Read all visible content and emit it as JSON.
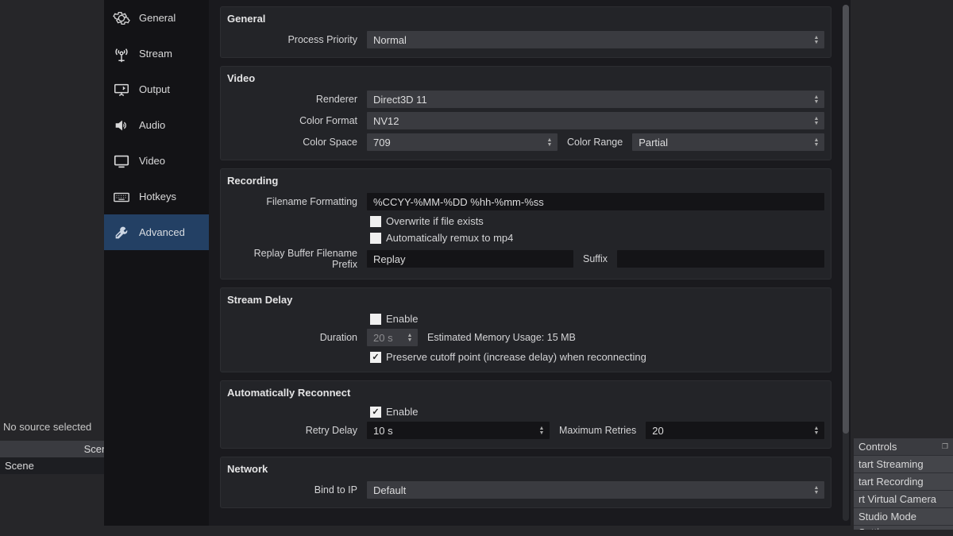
{
  "peek": {
    "no_source": "No source selected",
    "scenes_header": "Scenes",
    "scene_name": "Scene",
    "controls_header": "Controls",
    "buttons": {
      "start_stream": "tart Streaming",
      "start_record": "tart Recording",
      "virtual_cam": "rt Virtual Camera",
      "studio": "Studio Mode",
      "settings": "Settings"
    }
  },
  "sidebar": {
    "items": [
      {
        "label": "General"
      },
      {
        "label": "Stream"
      },
      {
        "label": "Output"
      },
      {
        "label": "Audio"
      },
      {
        "label": "Video"
      },
      {
        "label": "Hotkeys"
      },
      {
        "label": "Advanced"
      }
    ]
  },
  "sections": {
    "general": {
      "title": "General",
      "process_priority_label": "Process Priority",
      "process_priority_value": "Normal"
    },
    "video": {
      "title": "Video",
      "renderer_label": "Renderer",
      "renderer_value": "Direct3D 11",
      "color_format_label": "Color Format",
      "color_format_value": "NV12",
      "color_space_label": "Color Space",
      "color_space_value": "709",
      "color_range_label": "Color Range",
      "color_range_value": "Partial"
    },
    "recording": {
      "title": "Recording",
      "filename_fmt_label": "Filename Formatting",
      "filename_fmt_value": "%CCYY-%MM-%DD %hh-%mm-%ss",
      "overwrite_label": "Overwrite if file exists",
      "remux_label": "Automatically remux to mp4",
      "replay_prefix_label": "Replay Buffer Filename Prefix",
      "replay_prefix_value": "Replay",
      "suffix_label": "Suffix",
      "suffix_value": ""
    },
    "stream_delay": {
      "title": "Stream Delay",
      "enable_label": "Enable",
      "duration_label": "Duration",
      "duration_value": "20 s",
      "est_mem_label": "Estimated Memory Usage: 15 MB",
      "preserve_label": "Preserve cutoff point (increase delay) when reconnecting"
    },
    "reconnect": {
      "title": "Automatically Reconnect",
      "enable_label": "Enable",
      "retry_delay_label": "Retry Delay",
      "retry_delay_value": "10 s",
      "max_retries_label": "Maximum Retries",
      "max_retries_value": "20"
    },
    "network": {
      "title": "Network",
      "bind_ip_label": "Bind to IP",
      "bind_ip_value": "Default"
    }
  }
}
